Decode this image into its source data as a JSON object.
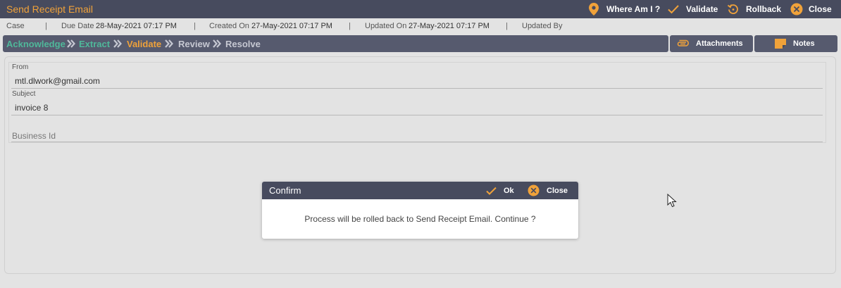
{
  "window": {
    "title": "Send Receipt Email"
  },
  "toolbar": {
    "where_am_i": "Where Am I ?",
    "validate": "Validate",
    "rollback": "Rollback",
    "close": "Close"
  },
  "info": {
    "case_label": "Case",
    "due_date_label": "Due Date",
    "due_date_value": "28-May-2021 07:17 PM",
    "created_on_label": "Created On",
    "created_on_value": "27-May-2021 07:17 PM",
    "updated_on_label": "Updated On",
    "updated_on_value": "27-May-2021 07:17 PM",
    "updated_by_label": "Updated By",
    "separator": "|"
  },
  "workflow": {
    "steps": [
      {
        "label": "Acknowledge",
        "color": "#4fb89a"
      },
      {
        "label": "Extract",
        "color": "#4fb89a"
      },
      {
        "label": "Validate",
        "color": "#f0a23a"
      },
      {
        "label": "Review",
        "color": "#c6c8d2"
      },
      {
        "label": "Resolve",
        "color": "#c6c8d2"
      }
    ]
  },
  "tabs": {
    "attachments": "Attachments",
    "notes": "Notes"
  },
  "form": {
    "from_label": "From",
    "from_value": "mtl.dlwork@gmail.com",
    "subject_label": "Subject",
    "subject_value": "invoice 8",
    "business_id_placeholder": "Business Id"
  },
  "dialog": {
    "title": "Confirm",
    "ok": "Ok",
    "close": "Close",
    "message": "Process will be rolled back to Send Receipt Email. Continue ?"
  },
  "colors": {
    "header_bg": "#474b5e",
    "accent": "#f0a23a",
    "done_step": "#4fb89a"
  }
}
